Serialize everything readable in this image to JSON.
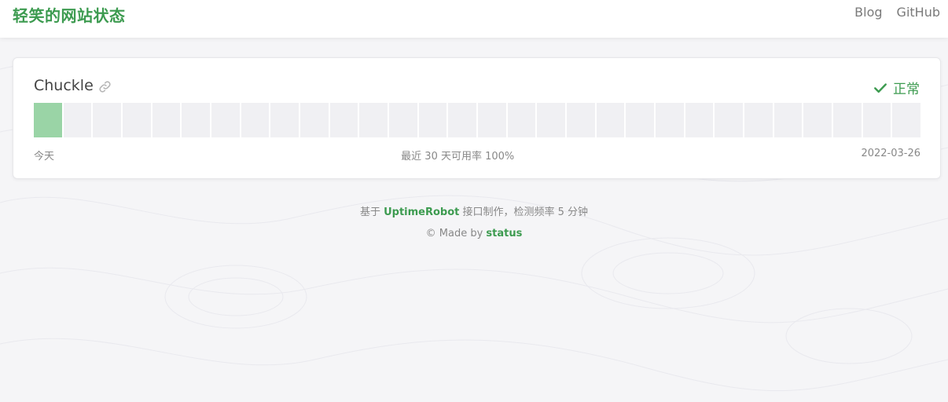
{
  "header": {
    "brand": "轻笑的网站状态",
    "nav": [
      "Blog",
      "GitHub"
    ]
  },
  "monitor": {
    "name": "Chuckle",
    "status": "正常",
    "bars": [
      "up",
      "none",
      "none",
      "none",
      "none",
      "none",
      "none",
      "none",
      "none",
      "none",
      "none",
      "none",
      "none",
      "none",
      "none",
      "none",
      "none",
      "none",
      "none",
      "none",
      "none",
      "none",
      "none",
      "none",
      "none",
      "none",
      "none",
      "none",
      "none",
      "none"
    ],
    "left_label": "今天",
    "center_label": "最近 30 天可用率 100%",
    "right_label": "2022-03-26"
  },
  "footer": {
    "line1_prefix": "基于 ",
    "line1_link": "UptimeRobot",
    "line1_suffix": " 接口制作，检测频率 5 分钟",
    "line2_prefix": "© Made by ",
    "line2_link": "status"
  },
  "colors": {
    "brand": "#3d9b50",
    "bar_up": "#9ad4a6",
    "bar_empty": "#f0f0f3",
    "background": "#f5f5f7"
  }
}
